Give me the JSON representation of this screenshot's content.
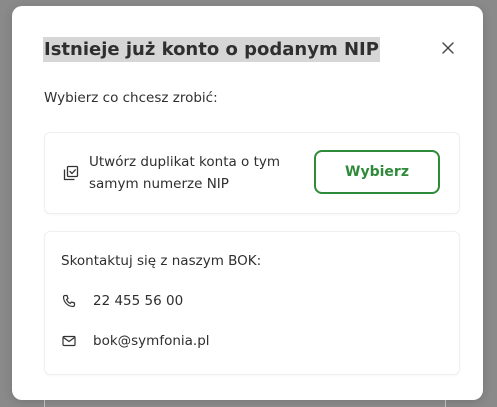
{
  "modal": {
    "title": "Istnieje już konto o podanym NIP",
    "close_icon": "close-icon",
    "subtitle": "Wybierz co chcesz zrobić:"
  },
  "duplicate_option": {
    "icon": "copy-check-icon",
    "text": "Utwórz duplikat konta o tym samym numerze NIP",
    "button_label": "Wybierz",
    "accent_color": "#2f8a3a"
  },
  "contact": {
    "title": "Skontaktuj się z naszym BOK:",
    "phone_icon": "phone-icon",
    "phone": "22 455 56 00",
    "email_icon": "mail-icon",
    "email": "bok@symfonia.pl"
  }
}
